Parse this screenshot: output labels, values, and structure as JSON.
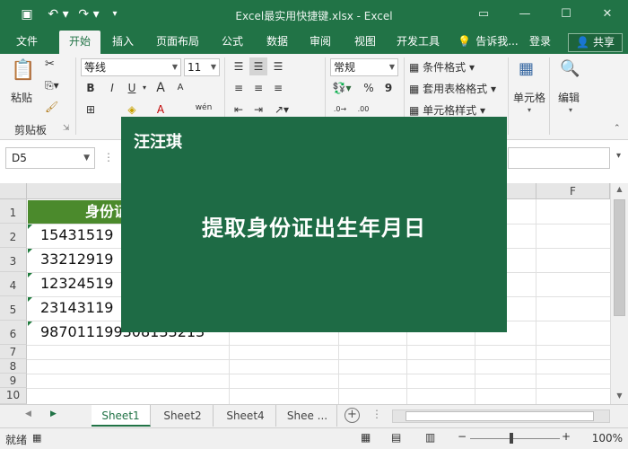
{
  "window": {
    "title": "Excel最实用快捷键.xlsx - Excel",
    "controls": [
      "▭",
      "—",
      "☐",
      "✕"
    ]
  },
  "quick_access": {
    "icons": [
      "save-icon",
      "undo-icon",
      "redo-icon",
      "customize-icon"
    ],
    "glyphs": [
      "▣",
      "↶ ▾",
      "↷ ▾",
      "▾"
    ]
  },
  "ribbon_tabs": [
    {
      "label": "文件"
    },
    {
      "label": "开始",
      "active": true
    },
    {
      "label": "插入"
    },
    {
      "label": "页面布局"
    },
    {
      "label": "公式"
    },
    {
      "label": "数据"
    },
    {
      "label": "审阅"
    },
    {
      "label": "视图"
    },
    {
      "label": "开发工具"
    },
    {
      "label": "告诉我..."
    },
    {
      "label": "登录"
    }
  ],
  "share_label": "共享",
  "ribbon": {
    "clipboard": {
      "paste_label": "粘贴",
      "group_label": "剪贴板"
    },
    "font": {
      "name": "等线",
      "size": "11",
      "bold": "B",
      "italic": "I",
      "underline": "U",
      "grow": "A",
      "shrink": "A",
      "phonetic": "wén"
    },
    "number": {
      "format": "常规",
      "percent": "%",
      "comma": "9"
    },
    "styles": {
      "conditional": "条件格式",
      "table": "套用表格格式",
      "cell_styles": "单元格样式"
    },
    "cells_label": "单元格",
    "editing_label": "编辑"
  },
  "formula_bar": {
    "name_box": "D5"
  },
  "grid": {
    "columns": [
      "F"
    ],
    "rows": [
      "1",
      "2",
      "3",
      "4",
      "5",
      "6",
      "7",
      "8",
      "9",
      "10"
    ],
    "header_text": "身份证",
    "cells": [
      "15431519",
      "33212919",
      "12324519",
      "23143119",
      "987011199308133213"
    ]
  },
  "sheets": {
    "tabs": [
      "Sheet1",
      "Sheet2",
      "Sheet4",
      "Shee ..."
    ],
    "active": "Sheet1",
    "add_glyph": "+"
  },
  "status": {
    "ready": "就绪",
    "zoom": "100%"
  },
  "overlay": {
    "author": "汪汪琪",
    "headline": "提取身份证出生年月日"
  }
}
